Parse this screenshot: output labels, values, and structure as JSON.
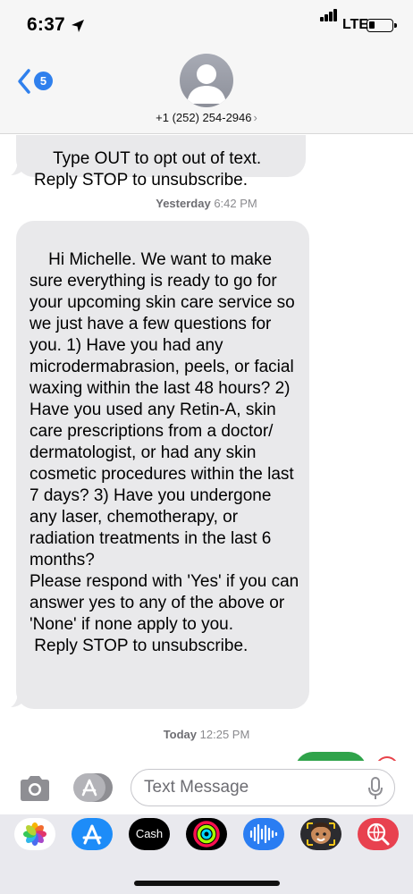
{
  "status_bar": {
    "time": "6:37",
    "network": "LTE",
    "battery_level": 0.25
  },
  "header": {
    "back_badge_count": "5",
    "contact_label": "+1 (252) 254-2946",
    "contact_chevron": "›"
  },
  "messages": {
    "partial_bubble_text": "Type OUT to opt out of text.\nReply STOP to unsubscribe.",
    "timestamp_1": {
      "day": "Yesterday",
      "time": "6:42 PM"
    },
    "main_bubble_text": "Hi Michelle. We want to make sure everything is ready to go for your upcoming skin care service so we just have a few questions for you. 1) Have you had any microdermabrasion, peels, or facial waxing within the last 48 hours? 2) Have you used any Retin-A, skin care prescriptions from a doctor/ dermatologist, or had any skin cosmetic procedures within the last 7 days? 3) Have you undergone any laser, chemotherapy, or radiation treatments in the last 6 months?\nPlease respond with 'Yes' if you can answer yes to any of the above or 'None' if none apply to you.\n Reply STOP to unsubscribe.",
    "timestamp_2": {
      "day": "Today",
      "time": "12:25 PM"
    }
  },
  "input_bar": {
    "placeholder": "Text Message"
  },
  "app_drawer": {
    "apps": [
      {
        "name": "photos-app-icon"
      },
      {
        "name": "app-store-icon"
      },
      {
        "name": "cash-app-icon",
        "label": "Cash"
      },
      {
        "name": "fitness-activity-icon"
      },
      {
        "name": "audio-message-icon"
      },
      {
        "name": "memoji-icon"
      },
      {
        "name": "web-search-icon"
      }
    ]
  },
  "colors": {
    "bubble_gray": "#e9e9eb",
    "ios_blue": "#2f80ed",
    "sent_green": "#2fa34a",
    "error_red": "#e8424a"
  }
}
